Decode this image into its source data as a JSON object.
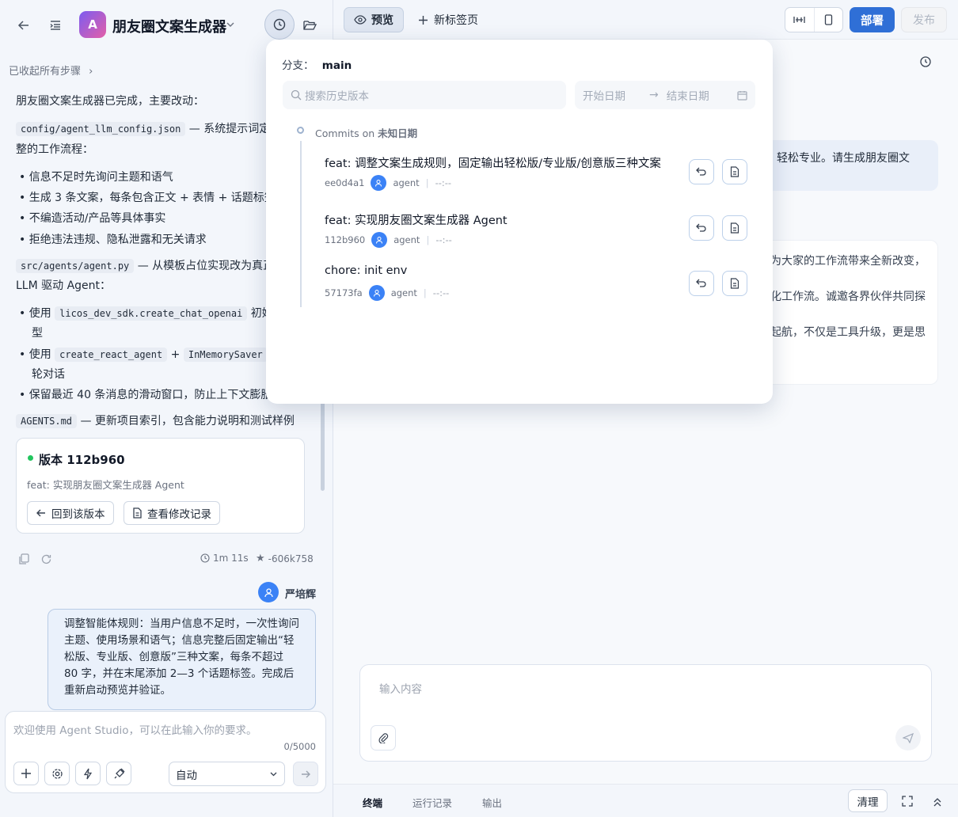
{
  "app": {
    "title": "朋友圈文案生成器",
    "logo_letter": "A",
    "collapsed": "已收起所有步骤",
    "accent": "#2f6fd6"
  },
  "summary": {
    "intro": "朋友圈文案生成器已完成，主要改动：",
    "f1_code": "config/agent_llm_config.json",
    "f1_text": " — 系统提示词定",
    "f1_text2": "整的工作流程：",
    "b1": [
      "信息不足时先询问主题和语气",
      "生成 3 条文案，每条包含正文 + 表情 + 话题标签",
      "不编造活动/产品等具体事实",
      "拒绝违法违规、隐私泄露和无关请求"
    ],
    "f2_code": "src/agents/agent.py",
    "f2_text": " — 从模板占位实现改为真正",
    "f2_text2": "LLM 驱动 Agent：",
    "b2_1_pre": "使用 ",
    "b2_1_code": "licos_dev_sdk.create_chat_openai",
    "b2_1_post": " 初始",
    "b2_1_cont": "型",
    "b2_2_pre": "使用 ",
    "b2_2_code": "create_react_agent",
    "b2_2_mid": " + ",
    "b2_2_code2": "InMemorySaver",
    "b2_2_cont": "轮对话",
    "b2_3": "保留最近 40 条消息的滑动窗口，防止上下文膨胀",
    "f3_code": "AGENTS.md",
    "f3_text": " — 更新项目索引，包含能力说明和测试样例"
  },
  "version_card": {
    "title": "版本 112b960",
    "desc": "feat: 实现朋友圈文案生成器 Agent",
    "btn_revert": "回到该版本",
    "btn_log": "查看修改记录"
  },
  "meta": {
    "duration": "1m 11s",
    "hash": "-606k758"
  },
  "user": {
    "name": "严培辉",
    "message": "调整智能体规则：当用户信息不足时，一次性询问主题、使用场景和语气；信息完整后固定输出“轻松版、专业版、创意版”三种文案，每条不超过 80 字，并在末尾添加 2—3 个话题标签。完成后重新启动预览并验证。"
  },
  "input": {
    "placeholder": "欢迎使用 Agent Studio，可以在此输入你的要求。",
    "counter": "0/5000",
    "mode": "自动"
  },
  "tabs": {
    "preview": "预览",
    "newtab": "新标签页"
  },
  "top": {
    "deploy": "部署",
    "publish": "发布"
  },
  "history": {
    "branch_label": "分支：",
    "branch": "main",
    "search_placeholder": "搜索历史版本",
    "start": "开始日期",
    "end": "结束日期",
    "group_prefix": "Commits on ",
    "group_date": "未知日期",
    "commits": [
      {
        "title": "feat: 调整文案生成规则，固定输出轻松版/专业版/创意版三种文案",
        "hash": "ee0d4a1",
        "author": "agent",
        "time": "--:--"
      },
      {
        "title": "feat: 实现朋友圈文案生成器 Agent",
        "hash": "112b960",
        "author": "agent",
        "time": "--:--"
      },
      {
        "title": "chore: init env",
        "hash": "57173fa",
        "author": "agent",
        "time": "--:--"
      }
    ]
  },
  "preview": {
    "bubble": "轻松专业。请生成朋友圈文",
    "lines": [
      "为大家的工作流带来全新改变，",
      "化工作流。诚邀各界伙伴共同探",
      "起航，不仅是工具升级，更是思"
    ],
    "input_placeholder": "输入内容"
  },
  "bottom": {
    "terminal": "终端",
    "runs": "运行记录",
    "output": "输出",
    "clear": "清理"
  }
}
